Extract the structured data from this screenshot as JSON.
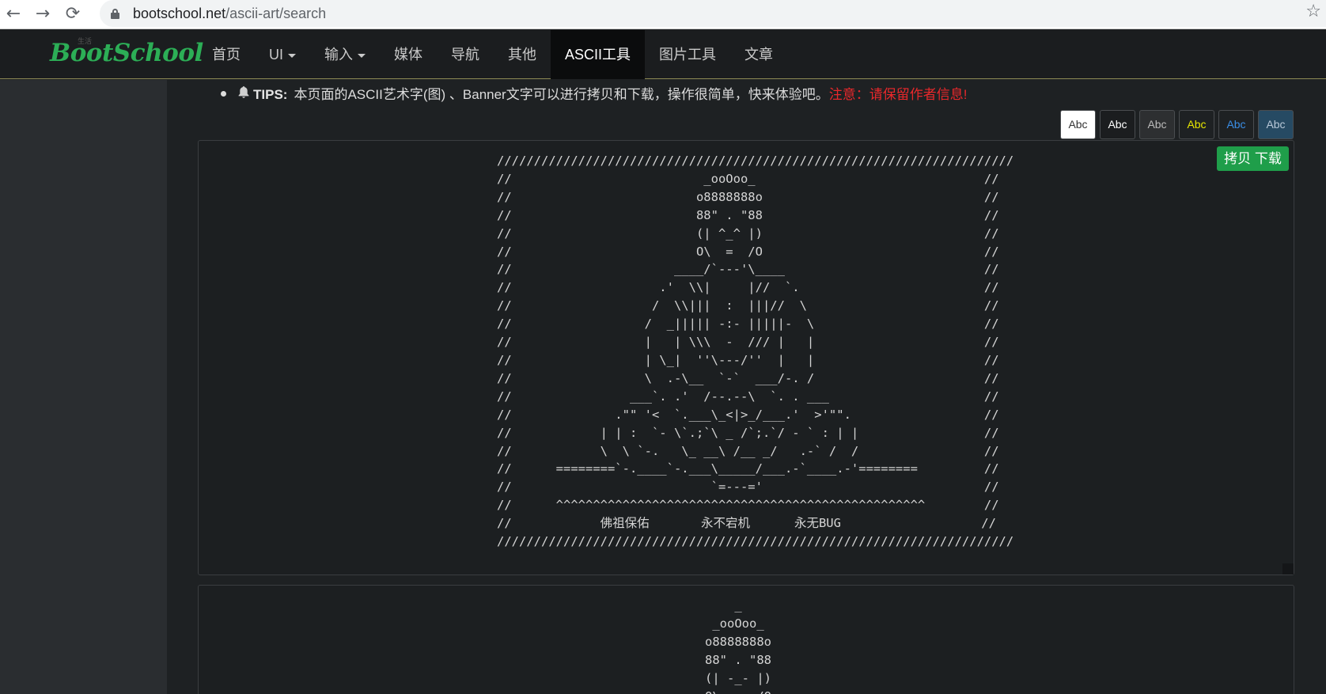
{
  "browser": {
    "url_host": "bootschool.net",
    "url_path": "/ascii-art/search",
    "back_glyph": "←",
    "forward_glyph": "→",
    "reload_glyph": "⟳",
    "star_glyph": "☆"
  },
  "navbar": {
    "brand": "BootSchool",
    "brand_tag": "生活",
    "items": [
      {
        "label": "首页"
      },
      {
        "label": "UI"
      },
      {
        "label": "输入"
      },
      {
        "label": "媒体"
      },
      {
        "label": "导航"
      },
      {
        "label": "其他"
      },
      {
        "label": "ASCII工具"
      },
      {
        "label": "图片工具"
      },
      {
        "label": "文章"
      }
    ],
    "active": "ASCII工具"
  },
  "tips": {
    "title": "TIPS:",
    "text": "本页面的ASCII艺术字(图) 、Banner文字可以进行拷贝和下载，操作很简单，快来体验吧。",
    "warning": "注意：请保留作者信息!"
  },
  "theme_buttons": [
    {
      "label": "Abc",
      "bg": "#ffffff",
      "fg": "#333333"
    },
    {
      "label": "Abc",
      "bg": "#1b1d1f",
      "fg": "#ffffff"
    },
    {
      "label": "Abc",
      "bg": "#2d2f31",
      "fg": "#bbbbbb"
    },
    {
      "label": "Abc",
      "bg": "#1e2123",
      "fg": "#e6e600"
    },
    {
      "label": "Abc",
      "bg": "#1e2123",
      "fg": "#3a8ee6"
    },
    {
      "label": "Abc",
      "bg": "#264a63",
      "fg": "#b8c8d8"
    }
  ],
  "copy_download_label": "拷贝 下载",
  "ascii_art_1": "//////////////////////////////////////////////////////////////////////\n//                          _ooOoo_                               //\n//                         o8888888o                              //\n//                         88\" . \"88                              //\n//                         (| ^_^ |)                              //\n//                         O\\  =  /O                              //\n//                      ____/`---'\\____                           //\n//                    .'  \\\\|     |//  `.                         //\n//                   /  \\\\|||  :  |||//  \\                        //\n//                  /  _||||| -:- |||||-  \\                       //\n//                  |   | \\\\\\  -  /// |   |                       //\n//                  | \\_|  ''\\---/''  |   |                       //\n//                  \\  .-\\__  `-`  ___/-. /                       //\n//                ___`. .'  /--.--\\  `. . ___                     //\n//              .\"\" '<  `.___\\_<|>_/___.'  >'\"\".                  //\n//            | | :  `- \\`.;`\\ _ /`;.`/ - ` : | |                 //\n//            \\  \\ `-.   \\_ __\\ /__ _/   .-` /  /                 //\n//      ========`-.____`-.___\\_____/___.-`____.-'========         //\n//                           `=---='                              //\n//      ^^^^^^^^^^^^^^^^^^^^^^^^^^^^^^^^^^^^^^^^^^^^^^^^^^        //\n//            佛祖保佑       永不宕机      永无BUG                   //\n//////////////////////////////////////////////////////////////////////",
  "ascii_art_2": "    _\n _ooOoo_\no8888888o\n88\" . \"88\n(| -_- |)\nO\\  =  /O"
}
